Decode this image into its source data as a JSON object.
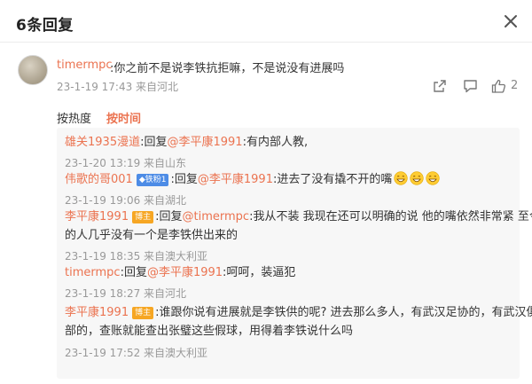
{
  "header": {
    "title": "6条回复"
  },
  "main_comment": {
    "user": "timermpc",
    "text": ":你之前不是说李铁抗拒嘛，不是说没有进展吗",
    "meta": "23-1-19 17:43 来自河北",
    "like_count": "2"
  },
  "sort": {
    "hot": "按热度",
    "time": "按时间"
  },
  "replies": [
    {
      "user": "雄关1935漫道",
      "prefix": ":回复",
      "mention": "@李平康1991",
      "text": ":有内部人教,",
      "meta": "23-1-20 13:19 来自山东"
    },
    {
      "user": "伟歌的哥001",
      "badge": "铁粉1",
      "prefix": ":回复",
      "mention": "@李平康1991",
      "text": ":进去了没有撬不开的嘴",
      "meta": "23-1-19 19:06 来自湖北"
    },
    {
      "user": "李平康1991",
      "badge": "博主",
      "prefix": ":回复",
      "mention": "@timermpc",
      "text": ":我从不装 我现在还可以明确的说 他的嘴依然非常紧 至今抓",
      "text2": "的人几乎没有一个是李铁供出来的",
      "meta": "23-1-19 18:35 来自澳大利亚"
    },
    {
      "user": "timermpc",
      "prefix": ":回复",
      "mention": "@李平康1991",
      "text": ":呵呵，装逼犯",
      "meta": "23-1-19 18:27 来自河北"
    },
    {
      "user": "李平康1991",
      "badge": "博主",
      "text": ":谁跟你说有进展就是李铁供的呢? 进去那么多人，有武汉足协的，有武汉俱乐",
      "text2": "部的，查账就能查出张璧这些假球，用得着李铁说什么吗",
      "meta": "23-1-19 17:52 来自澳大利亚"
    }
  ],
  "icons": {
    "close": "close-icon",
    "share": "share-icon",
    "comment": "comment-icon",
    "like": "thumb-up-icon",
    "emoji": "grin-emoji-icon"
  },
  "colors": {
    "accent": "#eb7350",
    "muted": "#999999",
    "reply_bg": "#f7f7f7",
    "fans_badge": "#4d8ce6",
    "blogger_badge": "#f6a623"
  }
}
